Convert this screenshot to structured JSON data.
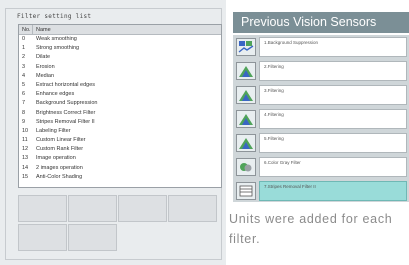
{
  "filter_panel": {
    "title": "Filter setting list",
    "header": {
      "no": "No.",
      "name": "Name"
    },
    "rows": [
      {
        "no": "0",
        "name": "Weak smoothing"
      },
      {
        "no": "1",
        "name": "Strong smoothing"
      },
      {
        "no": "2",
        "name": "Dilate"
      },
      {
        "no": "3",
        "name": "Erosion"
      },
      {
        "no": "4",
        "name": "Median"
      },
      {
        "no": "5",
        "name": "Extract horizontal edges"
      },
      {
        "no": "6",
        "name": "Enhance edges"
      },
      {
        "no": "7",
        "name": "Background Suppression"
      },
      {
        "no": "8",
        "name": "Brightness Correct Filter"
      },
      {
        "no": "9",
        "name": "Stripes Removal Filter II"
      },
      {
        "no": "10",
        "name": "Labeling Filter"
      },
      {
        "no": "11",
        "name": "Custom Linear Filter"
      },
      {
        "no": "12",
        "name": "Custom Rank Filter"
      },
      {
        "no": "13",
        "name": "Image operation"
      },
      {
        "no": "14",
        "name": "2 images operation"
      },
      {
        "no": "15",
        "name": "Anti-Color Shading"
      }
    ]
  },
  "previous_sensors": {
    "title": "Previous Vision Sensors",
    "units": [
      {
        "label": "1.Background Suppression",
        "icon": "background-suppression-icon",
        "selected": false
      },
      {
        "label": "2.Filtering",
        "icon": "filtering-icon",
        "selected": false
      },
      {
        "label": "3.Filtering",
        "icon": "filtering-icon",
        "selected": false
      },
      {
        "label": "4.Filtering",
        "icon": "filtering-icon",
        "selected": false
      },
      {
        "label": "5.Filtering",
        "icon": "filtering-icon",
        "selected": false
      },
      {
        "label": "6.Color Gray Filter",
        "icon": "color-gray-filter-icon",
        "selected": false
      },
      {
        "label": "7.Stripes Removal Filter II",
        "icon": "stripes-removal-icon",
        "selected": true
      }
    ]
  },
  "caption": "Units were added for each filter.",
  "colors": {
    "title_bar": "#7b8f96",
    "selected_unit": "#99dcd9",
    "icon_green": "#4fa35a",
    "icon_blue": "#3a66c4"
  }
}
